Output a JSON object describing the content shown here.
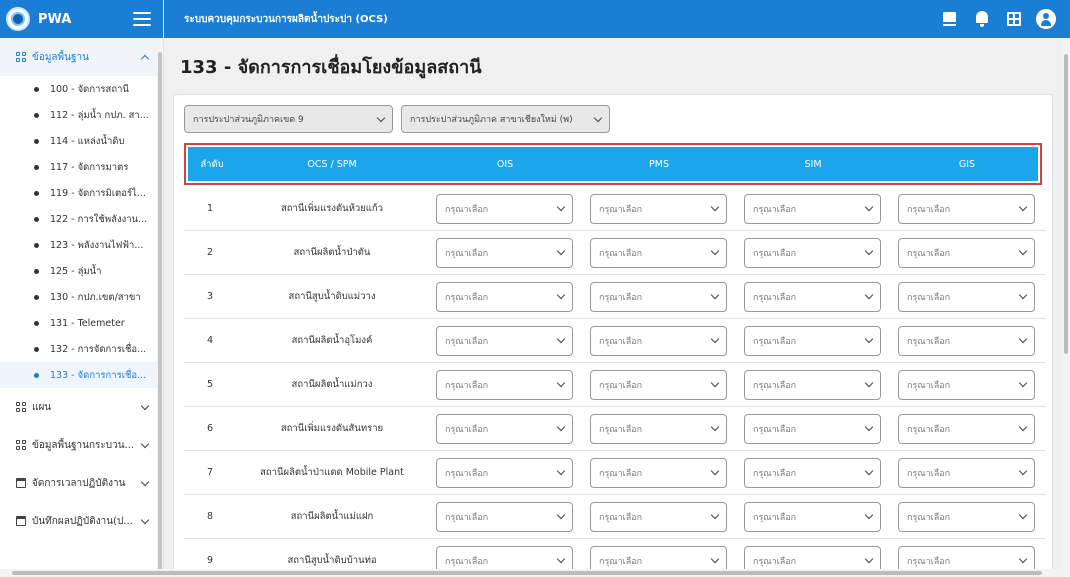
{
  "app": {
    "name": "PWA",
    "system_title": "ระบบควบคุมกระบวนการผลิตน้ำประปา (OCS)"
  },
  "sidebar": {
    "master_group": "ข้อมูลพื้นฐาน",
    "items": [
      "100 - จัดการสถานี",
      "112 - ลุ่มน้ำ กปภ. สา...",
      "114 - แหล่งน้ำดิบ",
      "117 - จัดการมาตร",
      "119 - จัดการมิเตอร์ไ...",
      "122 - การใช้พลังงาน...",
      "123 - พลังงานไฟฟ้า...",
      "125 - ลุ่มน้ำ",
      "130 - กปภ.เขต/สาขา",
      "131 - Telemeter",
      "132 - การจัดการเชื่อ...",
      "133 - จัดการการเชื่อ..."
    ],
    "active_index": 11,
    "groups": [
      {
        "label": "แผน",
        "icon": "grid-icon"
      },
      {
        "label": "ข้อมูลพื้นฐานกระบวน...",
        "icon": "grid-icon"
      },
      {
        "label": "จัดการเวลาปฏิบัติงาน",
        "icon": "calendar-icon"
      },
      {
        "label": "บันทึกผลปฏิบัติงาน(ป...",
        "icon": "calendar-icon"
      }
    ]
  },
  "page": {
    "title": "133 - จัดการการเชื่อมโยงข้อมูลสถานี"
  },
  "filters": {
    "region": "การประปาส่วนภูมิภาคเขต 9",
    "branch": "การประปาส่วนภูมิภาค สาขาเชียงใหม่ (พ)"
  },
  "table": {
    "headers": [
      "ลำดับ",
      "OCS / SPM",
      "OIS",
      "PMS",
      "SIM",
      "GIS"
    ],
    "select_placeholder": "กรุณาเลือก",
    "rows": [
      {
        "no": "1",
        "station": "สถานีเพิ่มแรงดันห้วยแก้ว"
      },
      {
        "no": "2",
        "station": "สถานีผลิตน้ำป่าตัน"
      },
      {
        "no": "3",
        "station": "สถานีสูบน้ำดิบแม่วาง"
      },
      {
        "no": "4",
        "station": "สถานีผลิตน้ำอุโมงค์"
      },
      {
        "no": "5",
        "station": "สถานีผลิตน้ำแม่กวง"
      },
      {
        "no": "6",
        "station": "สถานีเพิ่มแรงดันสันทราย"
      },
      {
        "no": "7",
        "station": "สถานีผลิตน้ำป่าแดด Mobile Plant"
      },
      {
        "no": "8",
        "station": "สถานีผลิตน้ำแม่แฝก"
      },
      {
        "no": "9",
        "station": "สถานีสูบน้ำดิบบ้านท่อ"
      }
    ]
  },
  "icons": {
    "topbar": [
      "book-icon",
      "bell-icon",
      "apps-icon",
      "account-icon"
    ]
  },
  "colors": {
    "primary": "#1a7fd4",
    "table_header": "#1ba6ec",
    "highlight_border": "#d0453d"
  }
}
